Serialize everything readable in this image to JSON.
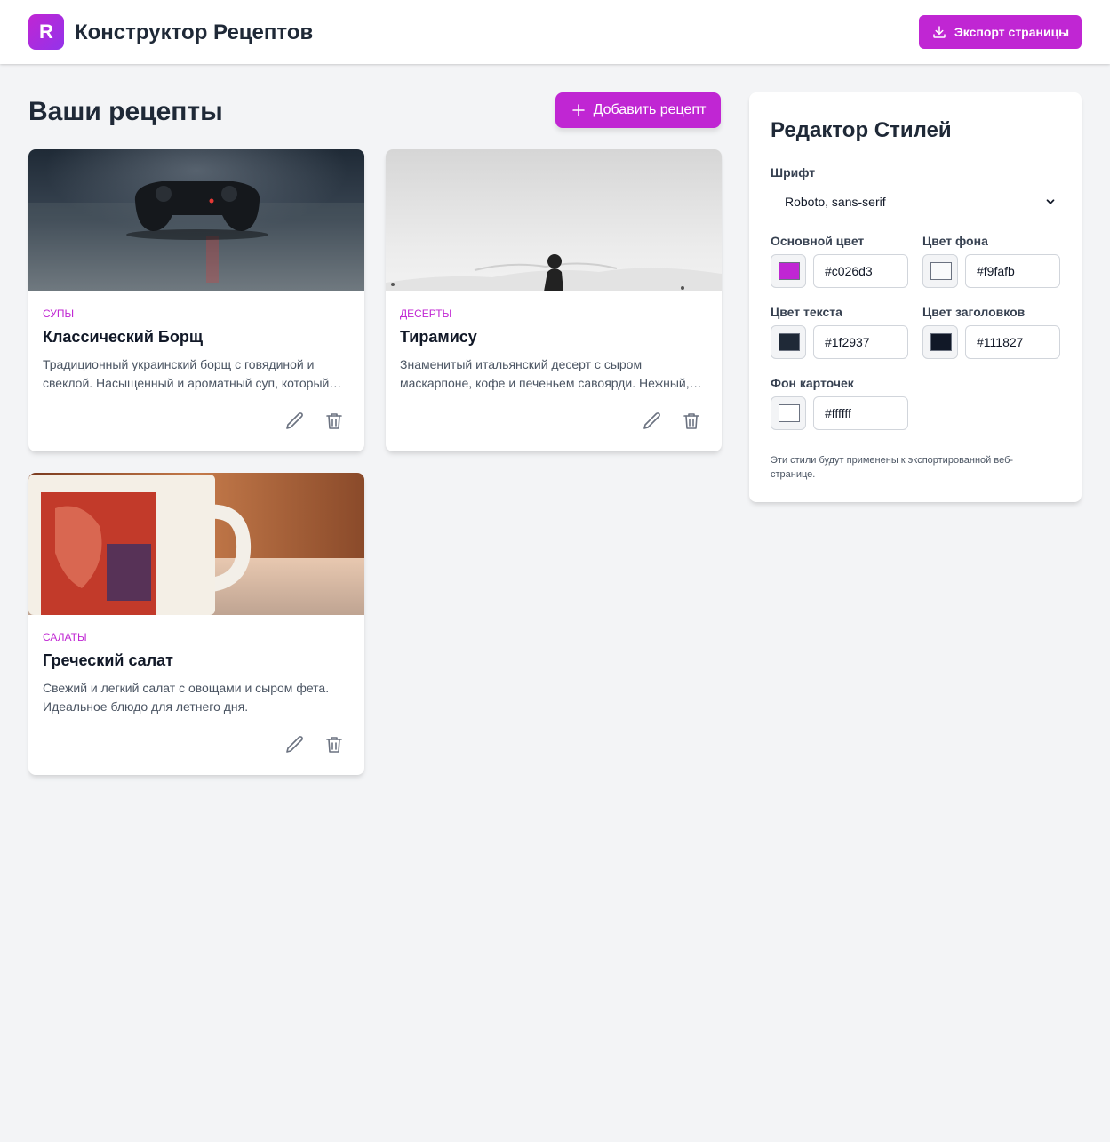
{
  "app": {
    "logo_letter": "R",
    "title": "Конструктор Рецептов",
    "export_label": "Экспорт страницы"
  },
  "main": {
    "title": "Ваши рецепты",
    "add_label": "Добавить рецепт",
    "recipes": [
      {
        "category": "СУПЫ",
        "title": "Классический Борщ",
        "description": "Традиционный украинский борщ с говядиной и свеклой. Насыщенный и ароматный суп, который…"
      },
      {
        "category": "ДЕСЕРТЫ",
        "title": "Тирамису",
        "description": "Знаменитый итальянский десерт с сыром маскарпоне, кофе и печеньем савоярди. Нежный,…"
      },
      {
        "category": "САЛАТЫ",
        "title": "Греческий салат",
        "description": "Свежий и легкий салат с овощами и сыром фета. Идеальное блюдо для летнего дня."
      }
    ]
  },
  "editor": {
    "title": "Редактор Стилей",
    "font_label": "Шрифт",
    "font_value": "Roboto, sans-serif",
    "primary_label": "Основной цвет",
    "primary_value": "#c026d3",
    "bg_label": "Цвет фона",
    "bg_value": "#f9fafb",
    "text_label": "Цвет текста",
    "text_value": "#1f2937",
    "heading_label": "Цвет заголовков",
    "heading_value": "#111827",
    "card_label": "Фон карточек",
    "card_value": "#ffffff",
    "note": "Эти стили будут применены к экспортированной веб-странице."
  },
  "icons": {
    "export": "download-icon",
    "add": "plus-icon",
    "edit": "pencil-icon",
    "delete": "trash-icon",
    "select": "chevron-down-icon"
  }
}
